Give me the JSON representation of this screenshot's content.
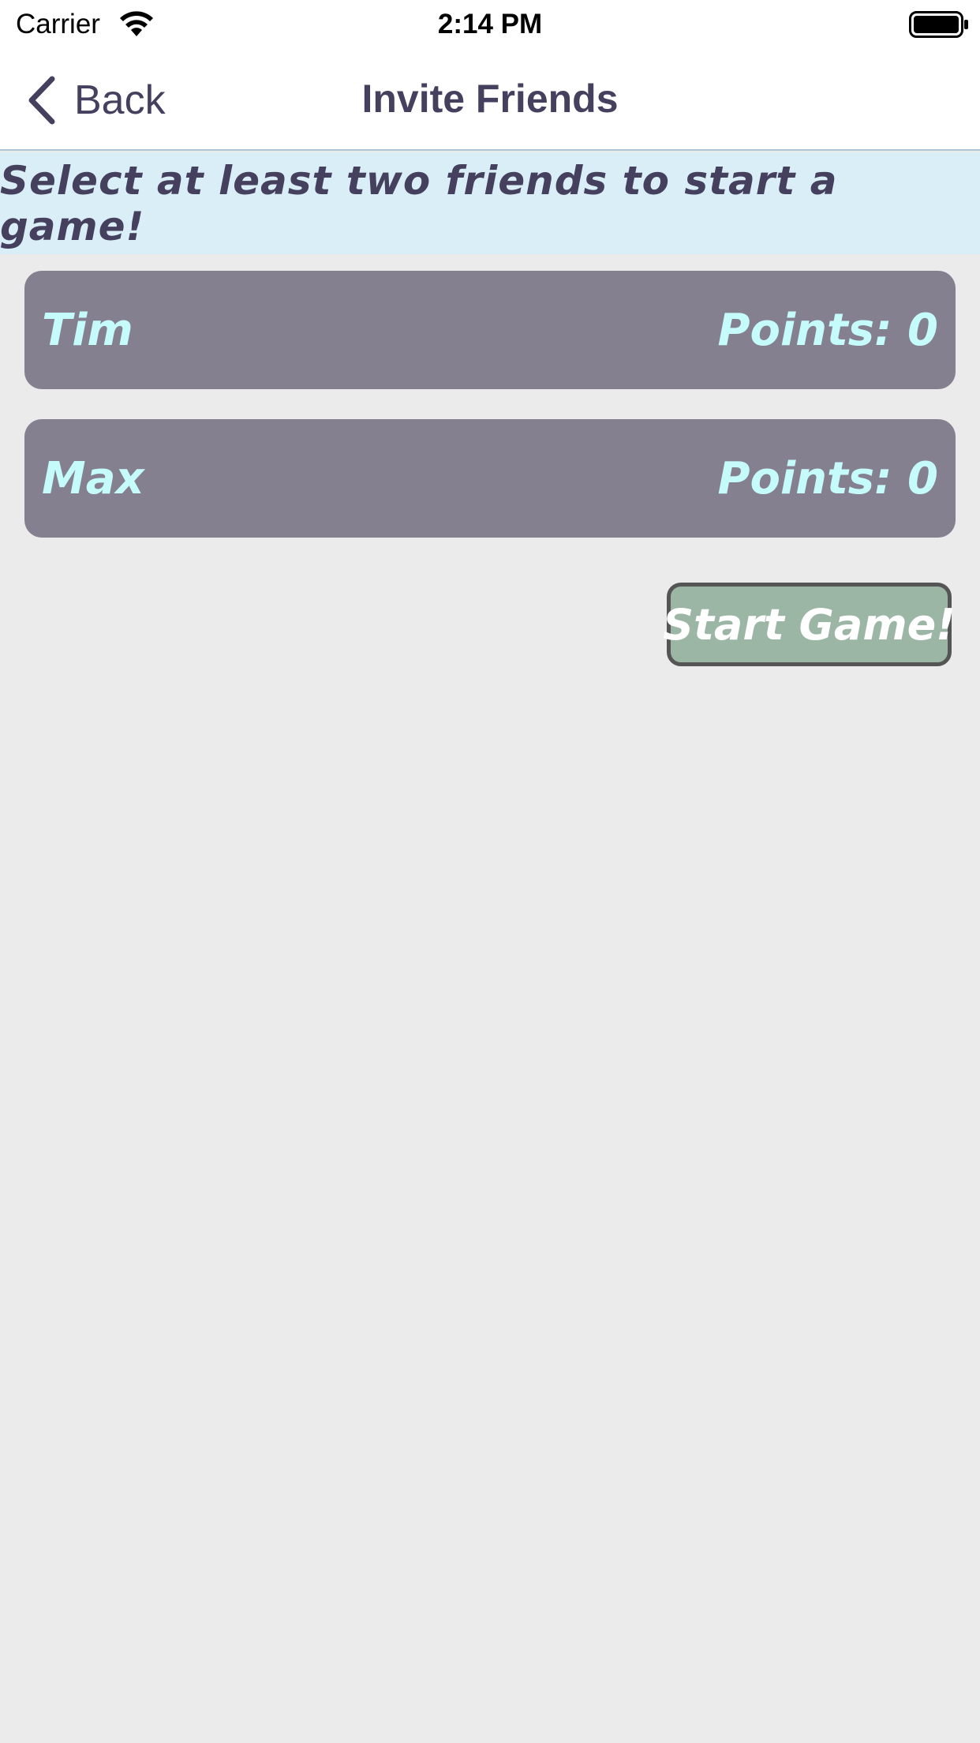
{
  "status_bar": {
    "carrier": "Carrier",
    "time": "2:14 PM",
    "wifi_icon": "wifi-icon",
    "battery_icon": "battery-icon"
  },
  "nav": {
    "back_label": "Back",
    "back_icon": "chevron-left-icon",
    "title": "Invite Friends"
  },
  "banner": {
    "text": "Select at least two friends to start a game!"
  },
  "friends": [
    {
      "name": "Tim",
      "points": "Points: 0"
    },
    {
      "name": "Max",
      "points": "Points: 0"
    }
  ],
  "actions": {
    "start_label": "Start Game!"
  },
  "colors": {
    "nav_text": "#45405e",
    "banner_bg": "#daeef7",
    "row_bg": "#84808f",
    "row_text": "#c6fbfb",
    "button_bg": "#9cb6a6",
    "button_border": "#555555",
    "page_bg": "#ebebec"
  }
}
